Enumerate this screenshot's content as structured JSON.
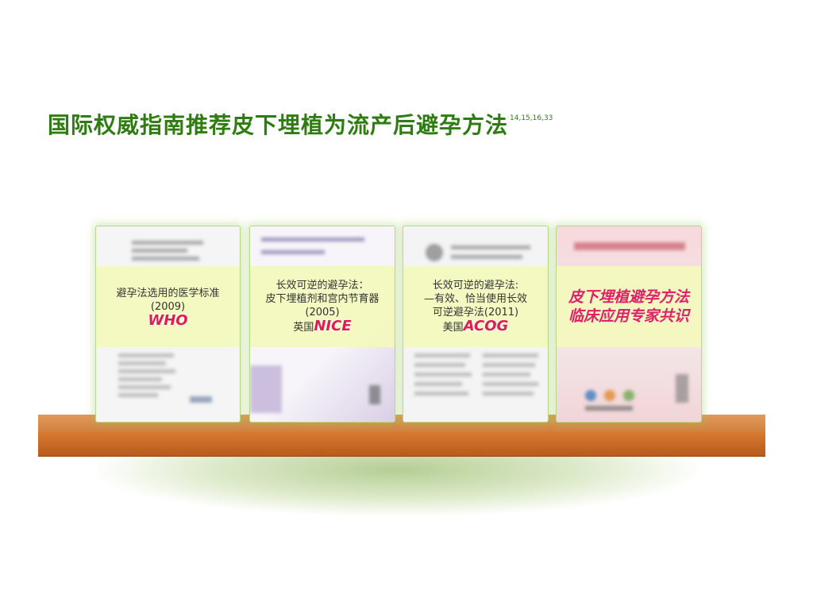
{
  "title": "国际权威指南推荐皮下埋植为流产后避孕方法",
  "title_refs": "14,15,16,33",
  "books": [
    {
      "id": "who",
      "lines": [
        "避孕法选用的医学标准",
        "(2009)"
      ],
      "org": "WHO"
    },
    {
      "id": "nice",
      "lines": [
        "长效可逆的避孕法：",
        "皮下埋植剂和宫内节育器",
        "(2005)"
      ],
      "org_prefix": "英国",
      "org": "NICE"
    },
    {
      "id": "acog",
      "lines": [
        "长效可逆的避孕法:",
        "—有效、恰当使用长效",
        "可逆避孕法(2011)"
      ],
      "org_prefix": "美国",
      "org": "ACOG"
    },
    {
      "id": "consensus",
      "lines": [
        "皮下埋植避孕方法",
        "临床应用专家共识"
      ]
    }
  ],
  "colors": {
    "title": "#2f7d12",
    "org": "#e01c54",
    "label_bg": "#f3f8be",
    "shelf": "#d2803e"
  }
}
